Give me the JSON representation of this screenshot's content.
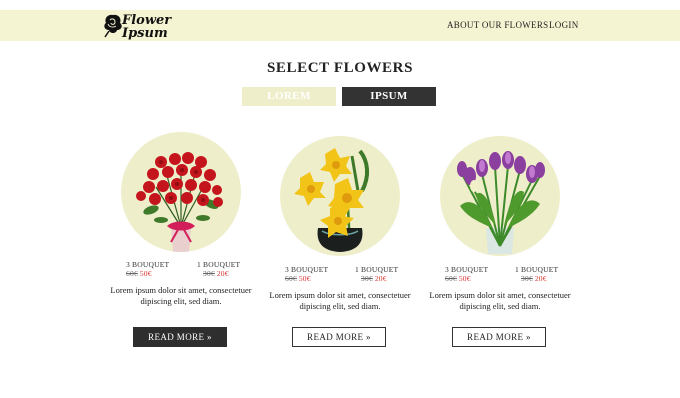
{
  "header": {
    "logo_line1": "Flower",
    "logo_line2": "Ipsum",
    "nav": [
      {
        "label": "ABOUT OUR FLOWERS"
      },
      {
        "label": "LOGIN"
      }
    ],
    "background_color": "#f5f4d2"
  },
  "main": {
    "title": "SELECT FLOWERS",
    "tabs": [
      {
        "label": "LOREM",
        "active": false
      },
      {
        "label": "IPSUM",
        "active": true
      }
    ]
  },
  "products": [
    {
      "image": "red-roses-bouquet",
      "three_label": "3 BOUQUET",
      "three_old": "60€",
      "three_new": "50€",
      "one_label": "1 BOUQUET",
      "one_old": "30€",
      "one_new": "20€",
      "description": "Lorem ipsum dolor sit amet, consectetuer dipiscing elit, sed diam.",
      "button": "READ MORE »",
      "button_style": "dark"
    },
    {
      "image": "yellow-daffodils-bouquet",
      "three_label": "3 BOUQUET",
      "three_old": "60€",
      "three_new": "50€",
      "one_label": "1 BOUQUET",
      "one_old": "30€",
      "one_new": "20€",
      "description": "Lorem ipsum dolor sit amet, consectetuer dipiscing elit, sed diam.",
      "button": "READ MORE »",
      "button_style": "light"
    },
    {
      "image": "purple-tulips-bouquet",
      "three_label": "3 BOUQUET",
      "three_old": "60€",
      "three_new": "50€",
      "one_label": "1 BOUQUET",
      "one_old": "30€",
      "one_new": "20€",
      "description": "Lorem ipsum dolor sit amet, consectetuer dipiscing elit, sed diam.",
      "button": "READ MORE »",
      "button_style": "light"
    }
  ],
  "colors": {
    "accent_cream": "#efeecb",
    "dark": "#333333",
    "sale_red": "#d9302c"
  }
}
